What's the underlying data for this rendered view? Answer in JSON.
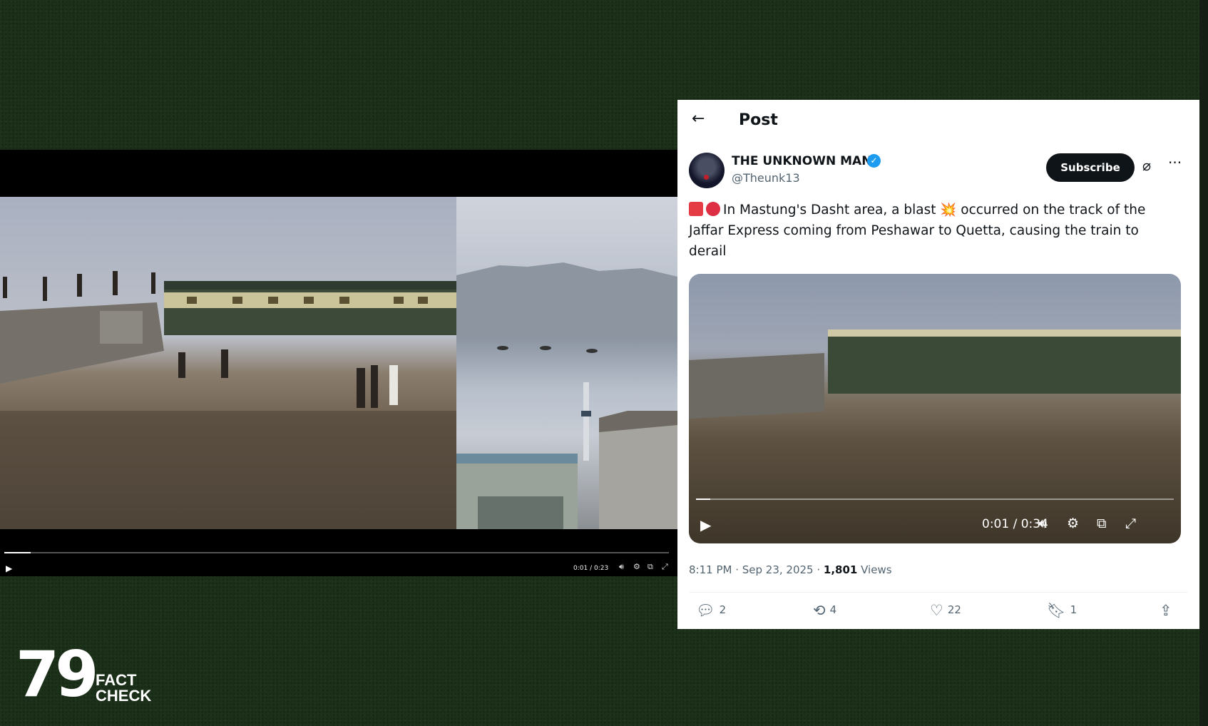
{
  "left_player": {
    "time": "0:01 / 0:23",
    "progress": 0.04,
    "controls": [
      "volume-icon",
      "settings-icon",
      "pip-icon",
      "fullscreen-icon"
    ]
  },
  "tweet": {
    "header_title": "Post",
    "author_name": "THE UNKNOWN MAN",
    "author_handle": "@Theunk13",
    "subscribe_label": "Subscribe",
    "text": "In Mastung's Dasht area, a blast 💥 occurred on the track of the Jaffar Express coming from Peshawar to Quetta, causing the train to derail",
    "video_time": "0:01 / 0:34",
    "video_progress": 0.03,
    "posted_time": "8:11 PM · Sep 23, 2025 · ",
    "views_count": "1,801",
    "views_label": "Views",
    "actions": {
      "replies": "2",
      "reposts": "4",
      "likes": "22",
      "bookmarks": "1"
    },
    "accent_color": "#1d9bf0"
  },
  "logo": {
    "mark": "79",
    "line1": "FACT",
    "line2": "CHECK"
  }
}
